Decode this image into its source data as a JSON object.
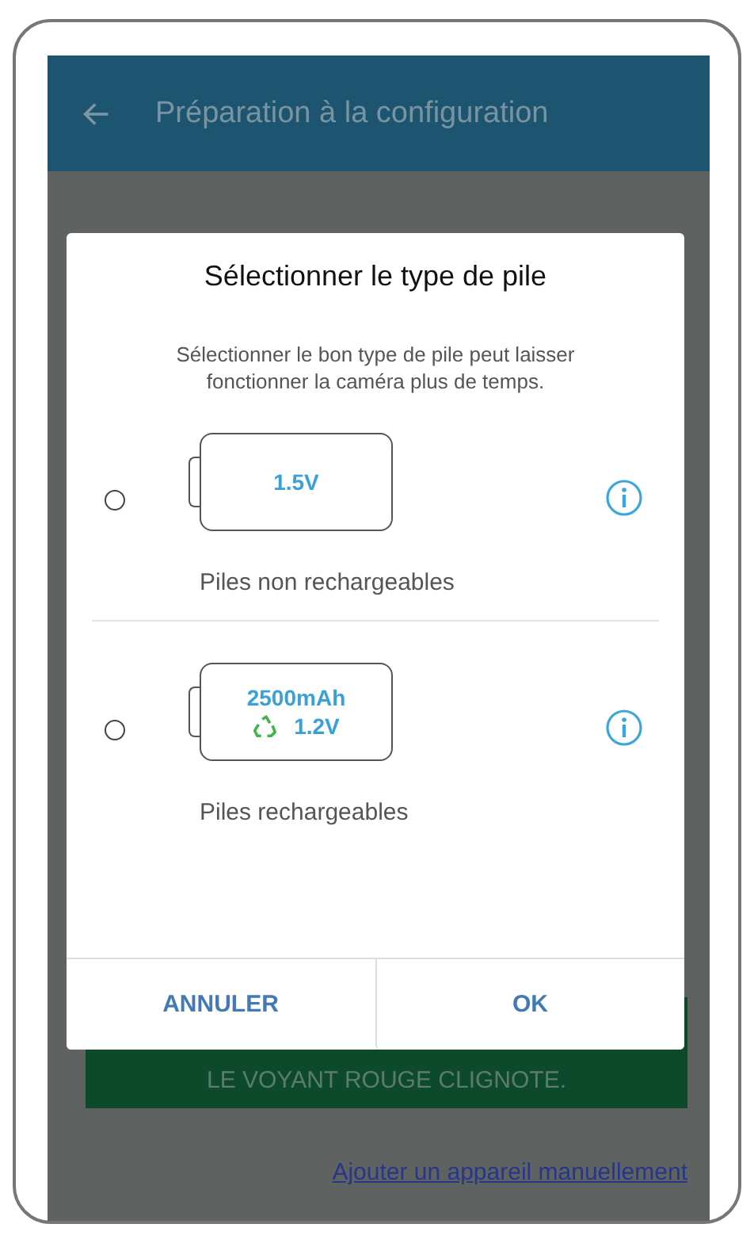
{
  "app_bar": {
    "title": "Préparation à la configuration"
  },
  "page": {
    "primary_button": "LE VOYANT ROUGE CLIGNOTE.",
    "link": "Ajouter un appareil manuellement"
  },
  "dialog": {
    "title": "Sélectionner le type de pile",
    "description": "Sélectionner le bon type de pile peut laisser fonctionner la caméra plus de temps.",
    "options": [
      {
        "label": "Piles non rechargeables",
        "selected": false,
        "battery_lines": [
          {
            "text": "1.5V",
            "recycle": false
          }
        ]
      },
      {
        "label": "Piles rechargeables",
        "selected": false,
        "battery_lines": [
          {
            "text": "2500mAh",
            "recycle": false
          },
          {
            "text": "1.2V",
            "recycle": true
          }
        ]
      }
    ],
    "buttons": [
      "ANNULER",
      "OK"
    ]
  }
}
